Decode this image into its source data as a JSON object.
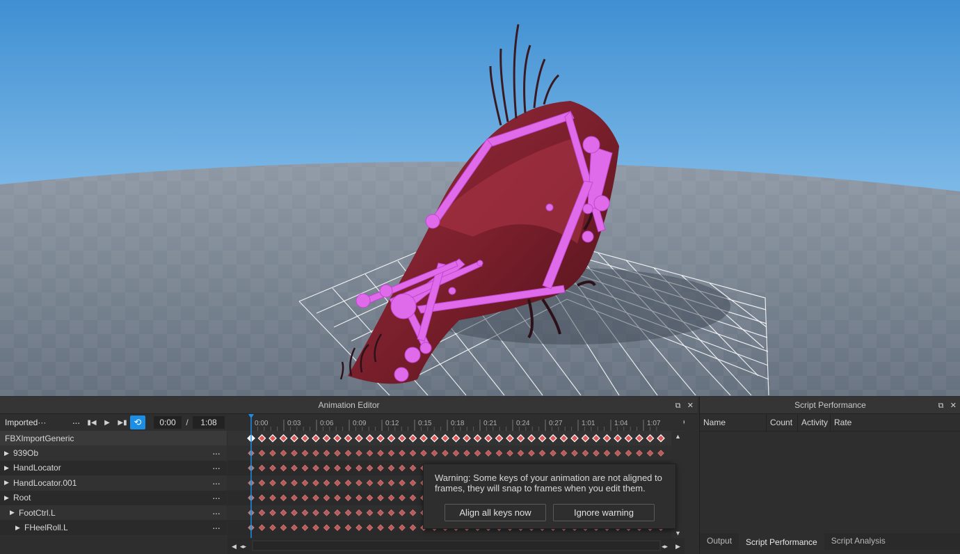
{
  "animation_editor": {
    "title": "Animation Editor",
    "animation_name": "Imported···",
    "current_time": "0:00",
    "time_separator": "/",
    "total_time": "1:08",
    "time_ticks": [
      "0:00",
      "0:03",
      "0:06",
      "0:09",
      "0:12",
      "0:15",
      "0:18",
      "0:21",
      "0:24",
      "0:27",
      "1:01",
      "1:04",
      "1:07"
    ],
    "tracks": [
      {
        "label": "FBXImportGeneric",
        "has_arrow": false,
        "indent": 0
      },
      {
        "label": "939Ob",
        "has_arrow": true,
        "indent": 0
      },
      {
        "label": "HandLocator",
        "has_arrow": true,
        "indent": 0
      },
      {
        "label": "HandLocator.001",
        "has_arrow": true,
        "indent": 0
      },
      {
        "label": "Root",
        "has_arrow": true,
        "indent": 0
      },
      {
        "label": "FootCtrl.L",
        "has_arrow": true,
        "indent": 1
      },
      {
        "label": "FHeelRoll.L",
        "has_arrow": true,
        "indent": 2
      }
    ],
    "more_options": "···",
    "playhead_color": "#1b8ee6",
    "keyframe_color": "#e05555"
  },
  "warning": {
    "message": "Warning: Some keys of your animation are not aligned to frames, they will snap to frames when you edit them.",
    "align_button": "Align all keys now",
    "ignore_button": "Ignore warning"
  },
  "script_performance": {
    "title": "Script Performance",
    "columns": [
      "Name",
      "Count",
      "Activity",
      "Rate"
    ],
    "tabs": [
      "Output",
      "Script Performance",
      "Script Analysis"
    ],
    "active_tab": "Script Performance"
  },
  "icons": {
    "first_frame": "skip-back-icon",
    "play": "play-icon",
    "last_frame": "skip-forward-icon",
    "loop": "loop-icon",
    "settings": "gear-icon",
    "undock": "undock-icon",
    "close": "close-icon"
  }
}
